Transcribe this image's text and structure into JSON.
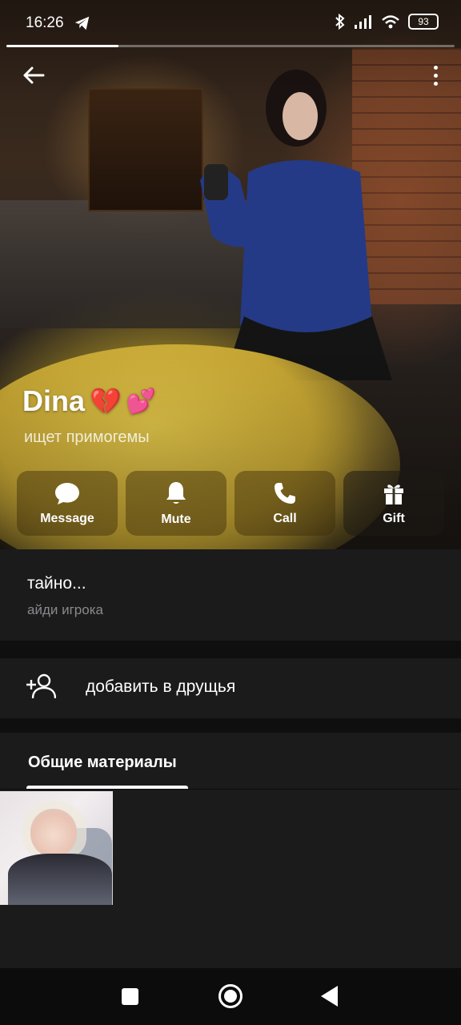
{
  "status_bar": {
    "time": "16:26",
    "battery": "93",
    "icons": [
      "telegram-icon",
      "bluetooth-icon",
      "signal-icon",
      "wifi-icon",
      "battery-icon"
    ]
  },
  "story_progress": 0.25,
  "profile": {
    "name": "Dina",
    "name_emoji_1": "💔",
    "name_emoji_2": "💕",
    "bio": "ищет примогемы"
  },
  "actions": [
    {
      "label": "Message",
      "icon": "message-icon"
    },
    {
      "label": "Mute",
      "icon": "bell-icon"
    },
    {
      "label": "Call",
      "icon": "phone-icon"
    },
    {
      "label": "Gift",
      "icon": "gift-icon"
    }
  ],
  "info": {
    "username": "тайно...",
    "username_caption": "айди игрока"
  },
  "add_friend": {
    "label": "добавить в друщья",
    "icon": "add-user-icon"
  },
  "media": {
    "tab_label": "Общие материалы"
  },
  "colors": {
    "background": "#1b1b1c",
    "section_gap": "#0f0f10",
    "caption": "#8a8a8d"
  }
}
